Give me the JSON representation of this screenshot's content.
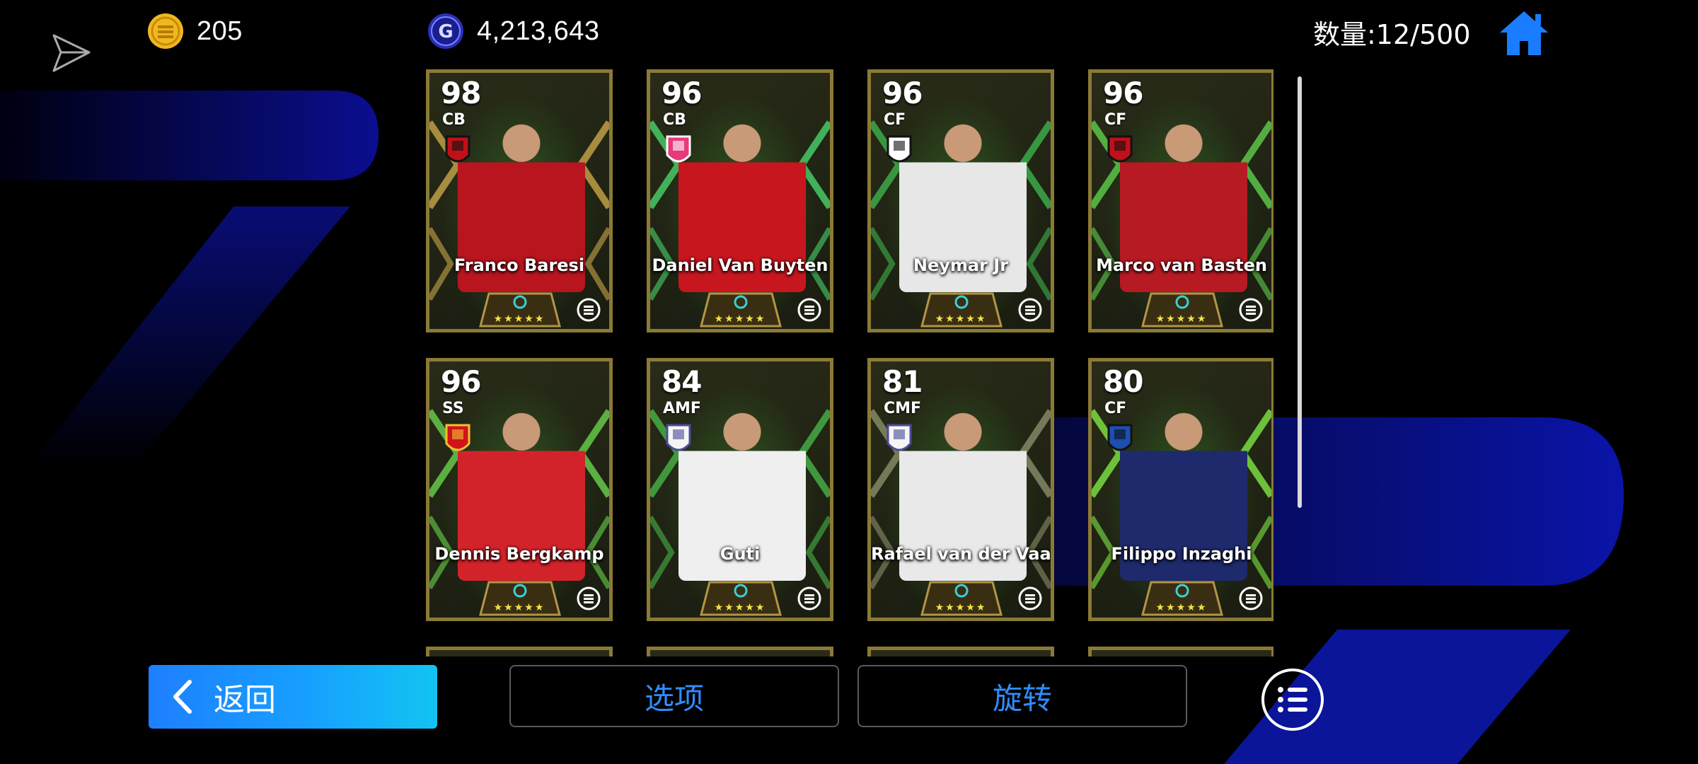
{
  "header": {
    "ecoins": "205",
    "gp": "4,213,643",
    "count_label": "数量:12/500"
  },
  "cards": [
    {
      "rating": "98",
      "position": "CB",
      "name": "Franco Baresi",
      "figure_color": "#b8151f",
      "accent": "#c9a64a",
      "club": "milan"
    },
    {
      "rating": "96",
      "position": "CB",
      "name": "Daniel Van Buyten",
      "figure_color": "#c8161f",
      "accent": "#4ad36b",
      "club": "mun"
    },
    {
      "rating": "96",
      "position": "CF",
      "name": "Neymar Jr",
      "figure_color": "#e7e7e7",
      "accent": "#3db34b",
      "club": "santos"
    },
    {
      "rating": "96",
      "position": "CF",
      "name": "Marco van Basten",
      "figure_color": "#b71a22",
      "accent": "#5fd04b",
      "club": "milan"
    },
    {
      "rating": "96",
      "position": "SS",
      "name": "Dennis Bergkamp",
      "figure_color": "#d3232a",
      "accent": "#69d34c",
      "club": "arsenal"
    },
    {
      "rating": "84",
      "position": "AMF",
      "name": "Guti",
      "figure_color": "#efefef",
      "accent": "#48b447",
      "club": "madrid"
    },
    {
      "rating": "81",
      "position": "CMF",
      "name": "Rafael van der Vaart",
      "figure_color": "#e9e9e9",
      "accent": "#8a8e6a",
      "club": "madrid"
    },
    {
      "rating": "80",
      "position": "CF",
      "name": "Filippo Inzaghi",
      "figure_color": "#1e2a6b",
      "accent": "#7fe843",
      "club": "atalanta"
    }
  ],
  "stars": "★★★★★",
  "buttons": {
    "back": "返回",
    "options": "选项",
    "rotate": "旋转"
  },
  "icons": {
    "send": "send-icon",
    "ecoin": "ecoin-icon",
    "gp": "gp-coin-icon",
    "home": "home-icon",
    "list": "list-icon",
    "back_chevron": "chevron-left-icon"
  },
  "colors": {
    "accent_blue": "#1a7dff",
    "button_text_blue": "#2f8dff",
    "card_border": "#8a7a35",
    "star": "#f4e24a"
  }
}
